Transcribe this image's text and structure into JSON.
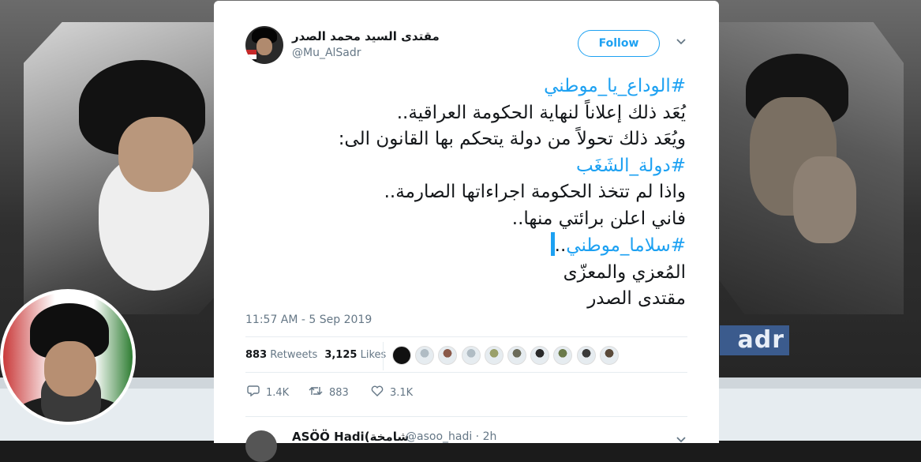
{
  "profile_header": {
    "banner_text": "adr",
    "colors": {
      "banner_accent": "#3b5b8d"
    }
  },
  "tweet": {
    "author_name": "مقتدى السيد محمد الصدر",
    "author_handle": "@Mu_AlSadr",
    "follow_label": "Follow",
    "body_lines": [
      {
        "text": "#الوداع_يا_موطني",
        "is_hashtag": true
      },
      {
        "text": "يُعَد ذلك إعلاناً لنهاية الحكومة العراقية..",
        "is_hashtag": false
      },
      {
        "text": "ويُعَد ذلك تحولاً من دولة يتحكم بها القانون الى:",
        "is_hashtag": false
      },
      {
        "text": "#دولة_الشَغَب",
        "is_hashtag": true
      },
      {
        "text": "واذا لم تتخذ الحكومة اجراءاتها الصارمة..",
        "is_hashtag": false
      },
      {
        "text": "فاني اعلن برائتي منها..",
        "is_hashtag": false
      },
      {
        "text": "#سلاما_موطني",
        "suffix": "..",
        "is_hashtag": true
      },
      {
        "text": "المُعزي والمعزّى",
        "is_hashtag": false
      },
      {
        "text": "مقتدى الصدر",
        "is_hashtag": false
      }
    ],
    "timestamp": "11:57 AM - 5 Sep 2019",
    "retweets_count": "883",
    "retweets_label": "Retweets",
    "likes_count": "3,125",
    "likes_label": "Likes",
    "liker_avatar_count": 10,
    "actions": {
      "reply_count": "1.4K",
      "retweet_count": "883",
      "like_count": "3.1K"
    },
    "colors": {
      "link": "#1da1f2",
      "text": "#14171a",
      "muted": "#657786"
    }
  },
  "next_reply": {
    "author_name": "ASÖÖ Hadi(شامخة",
    "author_handle": "@asoo_hadi · 2h"
  }
}
